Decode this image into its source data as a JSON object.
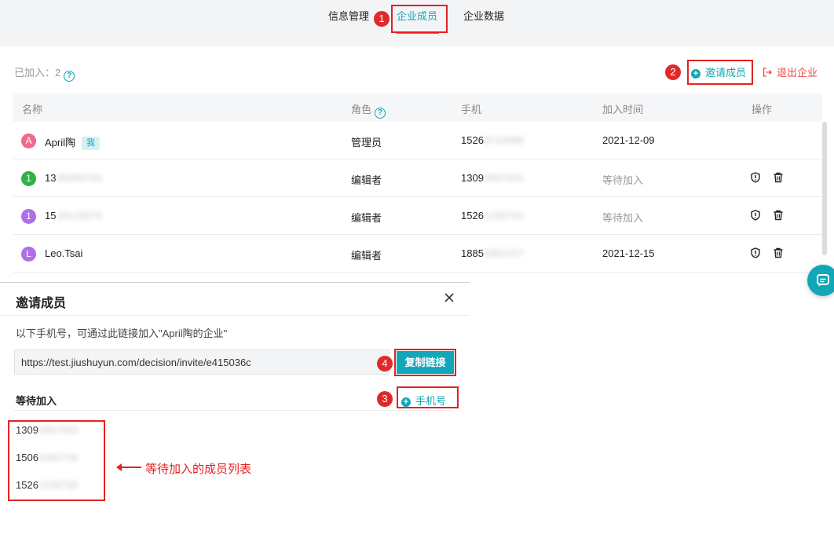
{
  "tabs": [
    {
      "label": "信息管理",
      "active": false
    },
    {
      "label": "企业成员",
      "active": true
    },
    {
      "label": "企业数据",
      "active": false
    }
  ],
  "header": {
    "joined_label": "已加入：",
    "joined_count": "2",
    "invite_label": "邀请成员",
    "exit_label": "退出企业"
  },
  "table": {
    "columns": [
      "名称",
      "角色",
      "手机",
      "加入时间",
      "操作"
    ],
    "rows": [
      {
        "avatar": "A",
        "avatar_color": "#f06b8b",
        "name": "April陶",
        "name_blur": "",
        "badge": "我",
        "role": "管理员",
        "phone": "1526",
        "phone_blur": "3710689",
        "time": "2021-12-09",
        "pending": false,
        "actions": false
      },
      {
        "avatar": "1",
        "avatar_color": "#2fb344",
        "name": "13",
        "name_blur": "09089763",
        "badge": "",
        "role": "编辑者",
        "phone": "1309",
        "phone_blur": "0897653",
        "time": "等待加入",
        "pending": true,
        "actions": true
      },
      {
        "avatar": "1",
        "avatar_color": "#b06ee8",
        "name": "15",
        "name_blur": "26123876",
        "badge": "",
        "role": "编辑者",
        "phone": "1526",
        "phone_blur": "1238765",
        "time": "等待加入",
        "pending": true,
        "actions": true
      },
      {
        "avatar": "L",
        "avatar_color": "#b06ee8",
        "name": "Leo.Tsai",
        "name_blur": "",
        "badge": "",
        "role": "编辑者",
        "phone": "1885",
        "phone_blur": "9382157",
        "time": "2021-12-15",
        "pending": false,
        "actions": true
      }
    ]
  },
  "dialog": {
    "title": "邀请成员",
    "description": "以下手机号，可通过此链接加入\"April陶的企业\"",
    "link": "https://test.jiushuyun.com/decision/invite/e415036c",
    "copy_label": "复制链接",
    "pending_label": "等待加入",
    "phone_add_label": "手机号",
    "pending_list": [
      {
        "visible": "1309",
        "blurred": "0897653"
      },
      {
        "visible": "1506",
        "blurred": "2082756"
      },
      {
        "visible": "1526",
        "blurred": "1238765"
      }
    ]
  },
  "annotations": {
    "markers": [
      "1",
      "2",
      "3",
      "4"
    ],
    "note": "等待加入的成员列表",
    "color": "#e32222"
  },
  "colors": {
    "accent": "#12a7b8",
    "danger": "#e94a4a"
  }
}
